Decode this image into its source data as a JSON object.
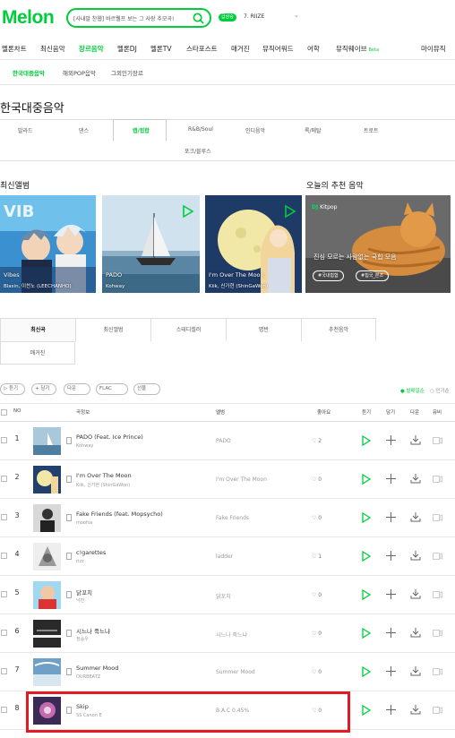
{
  "header": {
    "logo": "Melon",
    "search_value": "[사내말 찬웹] 바르웰프 보는 그 사랑 추모곡!",
    "live_badge": "급상승",
    "rank_item": "7. RIIZE"
  },
  "gnb": [
    "멜론차트",
    "최신음악",
    "장르음악",
    "멜론DJ",
    "멜론TV",
    "스타포스트",
    "매거진",
    "뮤직어워드",
    "어학",
    "뮤직웨이브",
    "마이뮤직"
  ],
  "gnb_beta": "Beta",
  "subnav": [
    "한국대중음악",
    "해외POP음악",
    "그외인기장르"
  ],
  "page_title": "한국대중음악",
  "genres": [
    "발라드",
    "댄스",
    "랩/힙합",
    "R&B/Soul",
    "인디음악",
    "록/메탈",
    "트로트",
    "포크/블루스"
  ],
  "latest_albums_title": "최신앨범",
  "albums": [
    {
      "title": "Vibes",
      "artist": "Blasin, 이찬노 (LEECHANHO)"
    },
    {
      "title": "PADO",
      "artist": "Kohway"
    },
    {
      "title": "I'm Over The Moon",
      "artist": "Kiik, 신가현 (ShinGaWon)"
    }
  ],
  "recommend": {
    "title": "오늘의 추천 음악",
    "dj": "DJ",
    "dj_name": "Kitpop",
    "caption": "진심 모르는 사람없는 국힙 모음",
    "tags": [
      "#국내힙합",
      "#힙국_본조"
    ]
  },
  "list_tabs": [
    "최신곡",
    "최신앨범",
    "스테디셀러",
    "명반",
    "추천음악",
    "매거진"
  ],
  "toolbar": {
    "buttons": [
      "▷ 듣기",
      "+ 담기",
      "다운",
      "FLAC",
      "선물"
    ],
    "dots": "○ ○",
    "sort_active": "● 발매일순",
    "sort_other": "○ 인기순"
  },
  "table_headers": [
    "NO",
    "곡정보",
    "앨범",
    "좋아요",
    "듣기",
    "담기",
    "다운",
    "뮤비"
  ],
  "songs": [
    {
      "no": "1",
      "title": "PADO (Feat. Ice Prince)",
      "artist": "Kohway",
      "album": "PADO",
      "likes": "♡ 2"
    },
    {
      "no": "2",
      "title": "I'm Over The Moon",
      "artist": "Kiik, 신가현 (ShinGaWon)",
      "album": "I'm Over The Moon",
      "likes": "♡ 0"
    },
    {
      "no": "3",
      "title": "Fake Friends (feat. Mopsycho)",
      "artist": "moofos",
      "album": "Fake Friends",
      "likes": "♡ 0"
    },
    {
      "no": "4",
      "title": "c!garettes",
      "artist": "rizz",
      "album": "ladder",
      "likes": "♡ 1"
    },
    {
      "no": "5",
      "title": "닭꼬치",
      "artist": "낙찬",
      "album": "닭꼬치",
      "likes": "♡ 0"
    },
    {
      "no": "6",
      "title": "시느나 죽느냐",
      "artist": "정승우",
      "album": "시느나 죽느냐",
      "likes": "♡ 0"
    },
    {
      "no": "7",
      "title": "Summer Mood",
      "artist": "OURBEATZ",
      "album": "Summer Mood",
      "likes": "♡ 0"
    },
    {
      "no": "8",
      "title": "Skip",
      "artist": "SS Canon E",
      "album": "B.A.C 0.45%",
      "likes": "♡ 0"
    }
  ],
  "colors": {
    "brand": "#00cd3c",
    "highlight": "#e01b24"
  }
}
